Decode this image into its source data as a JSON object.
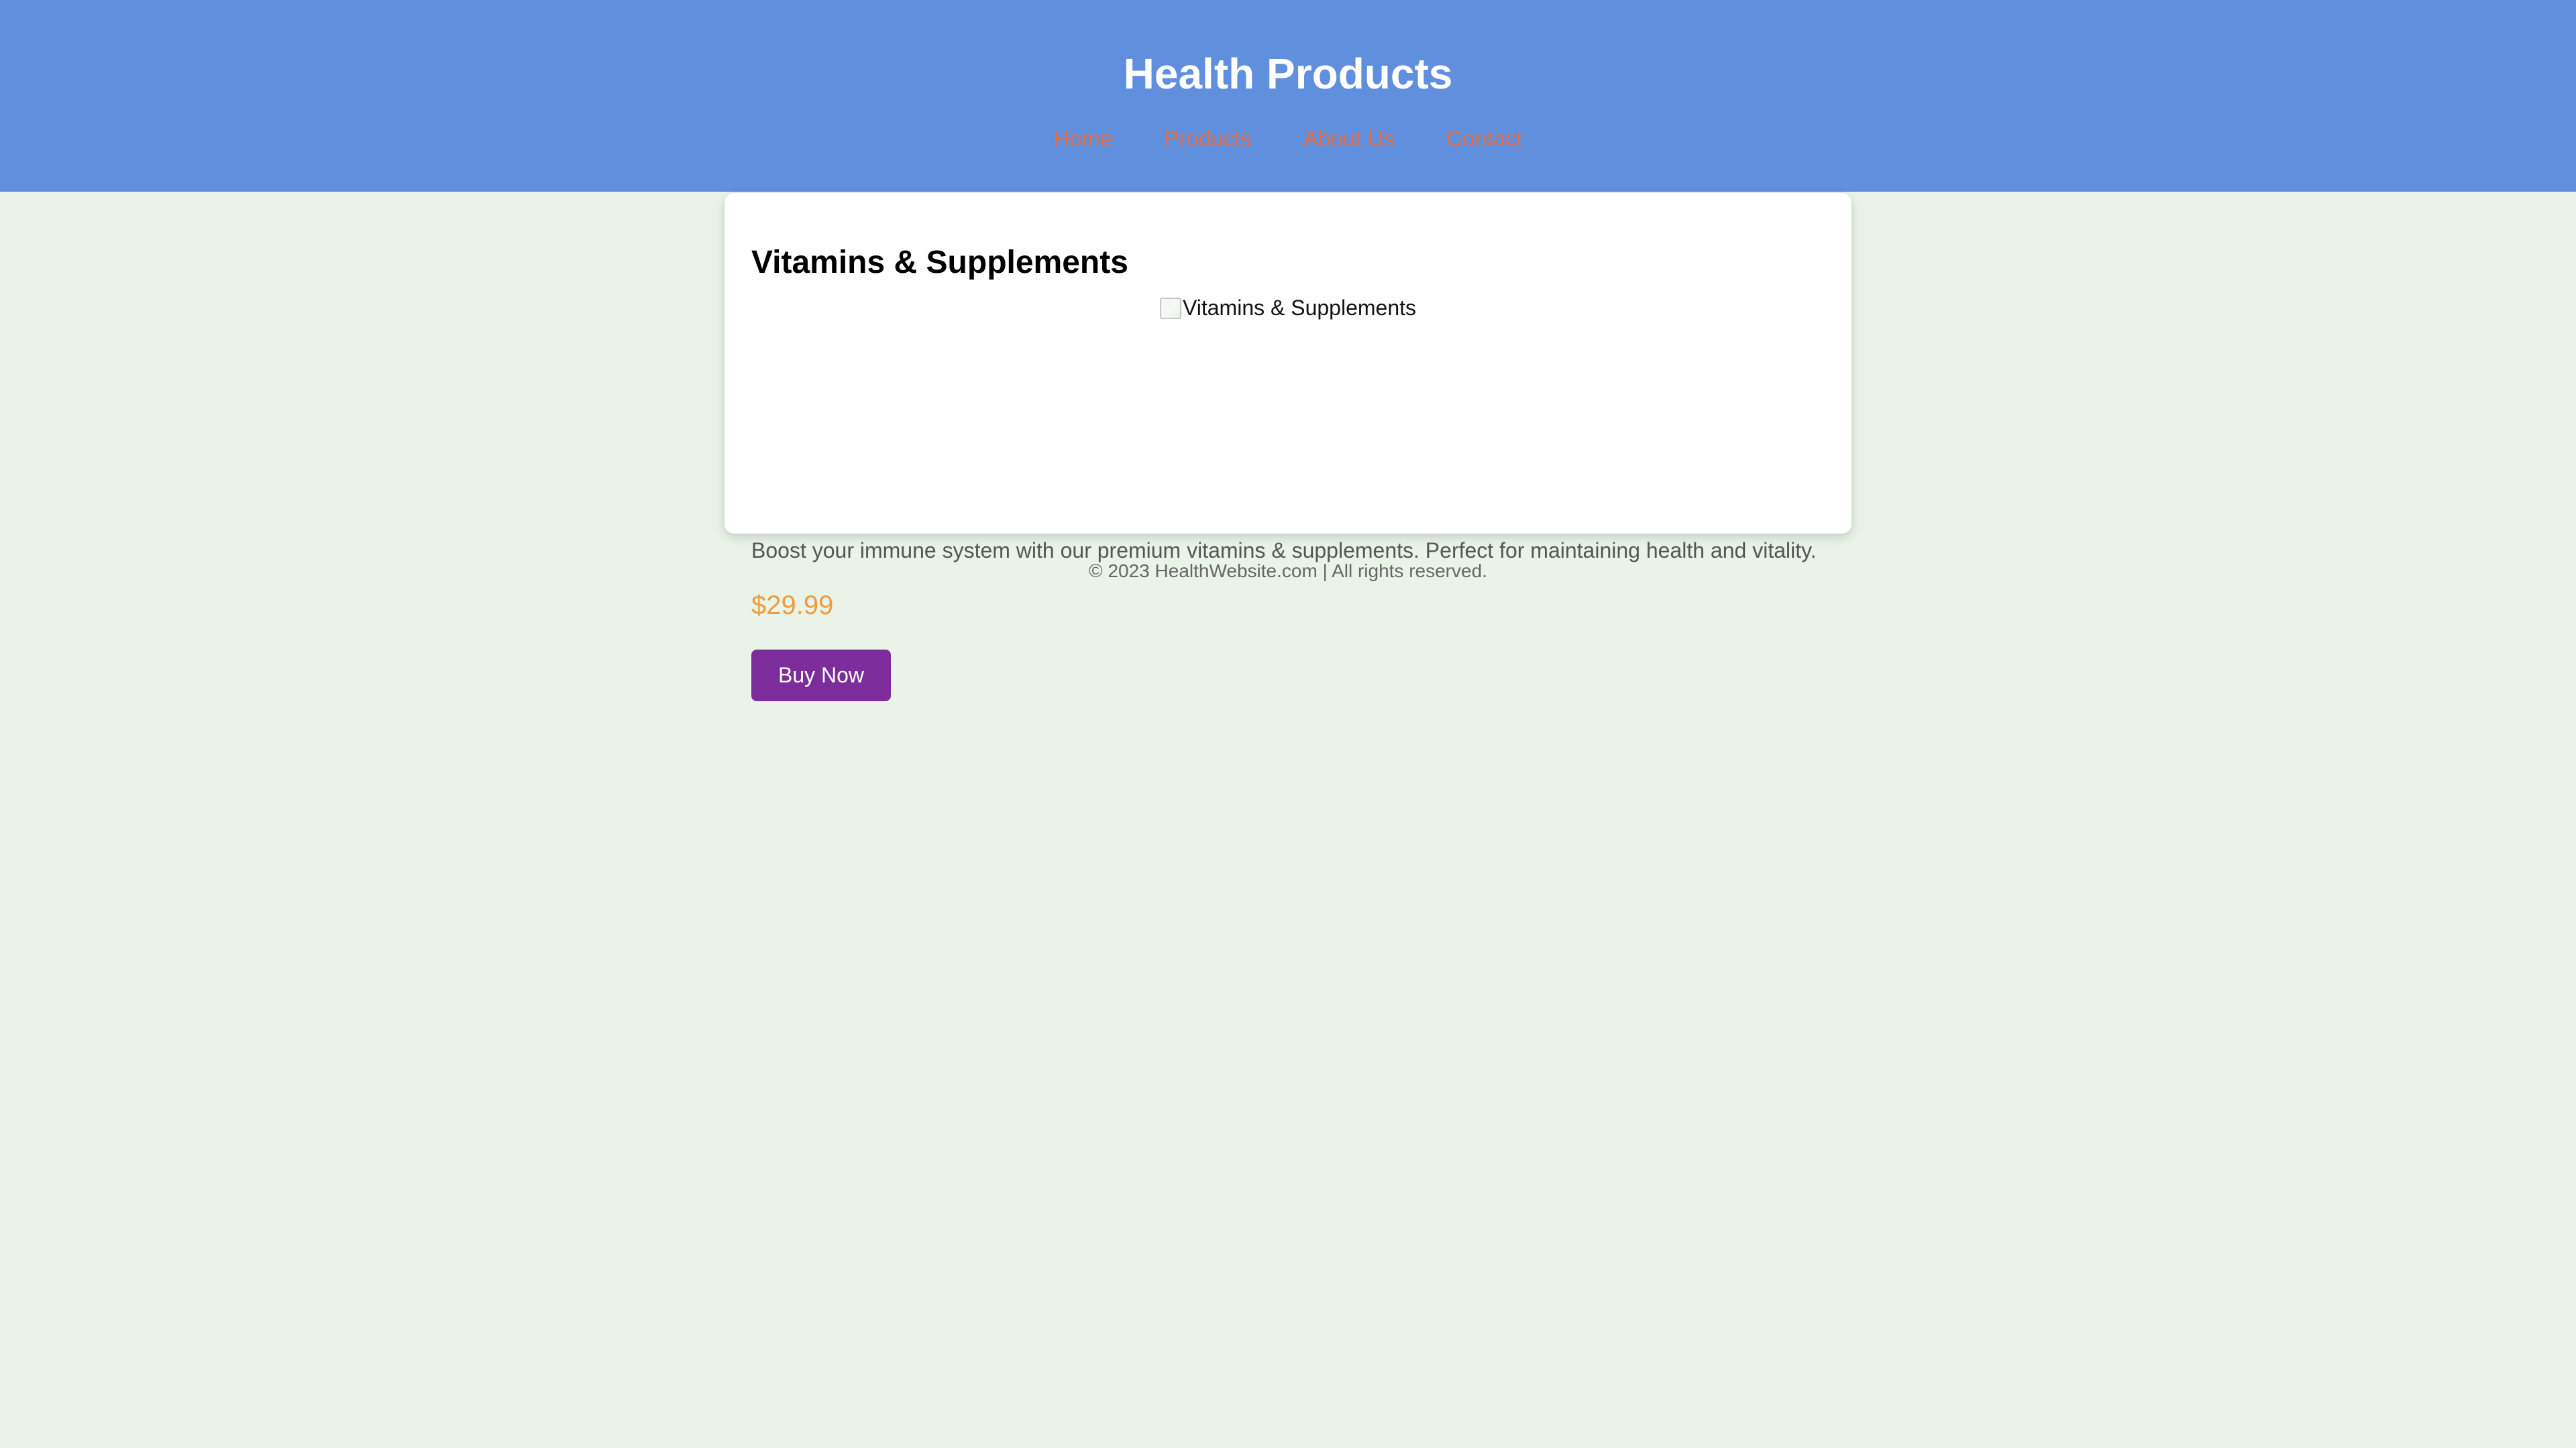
{
  "header": {
    "title": "Health Products",
    "nav": [
      {
        "label": "Home"
      },
      {
        "label": "Products"
      },
      {
        "label": "About Us"
      },
      {
        "label": "Contact"
      }
    ]
  },
  "product": {
    "title": "Vitamins & Supplements",
    "image_alt": "Vitamins & Supplements",
    "image_icon": "broken-image-icon",
    "description": "Boost your immune system with our premium vitamins & supplements. Perfect for maintaining health and vitality.",
    "price": "$29.99",
    "button_label": "Buy Now"
  },
  "footer": {
    "text": "© 2023 HealthWebsite.com | All rights reserved."
  },
  "colors": {
    "header_bg": "#5f8fdd",
    "page_bg": "#e9f3e8",
    "nav_link": "#ea6b3d",
    "price": "#f19a3e",
    "button_bg": "#7d2d9b"
  }
}
